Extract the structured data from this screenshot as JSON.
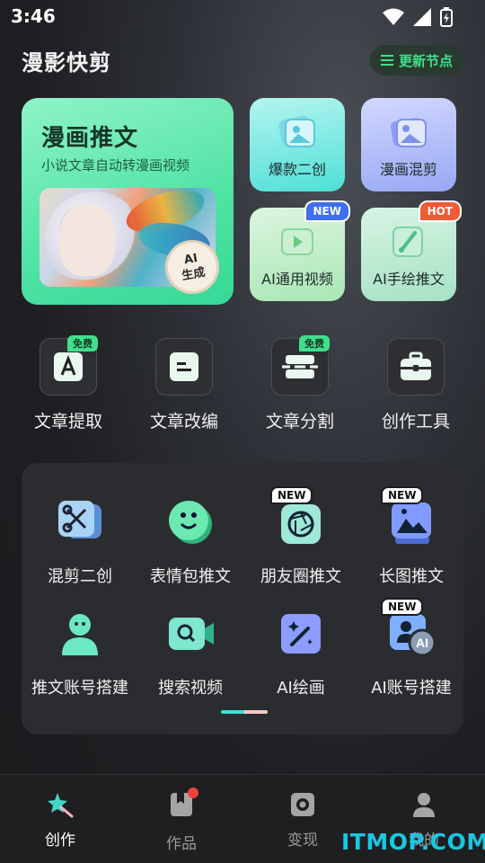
{
  "status": {
    "time": "3:46"
  },
  "header": {
    "title": "漫影快剪",
    "update_label": "更新节点"
  },
  "hero": {
    "title": "漫画推文",
    "subtitle": "小说文章自动转漫画视频",
    "badge_line1": "AI",
    "badge_line2": "生成"
  },
  "tiles": [
    {
      "label": "爆款二创",
      "tag": ""
    },
    {
      "label": "漫画混剪",
      "tag": ""
    },
    {
      "label": "AI通用视频",
      "tag": "NEW"
    },
    {
      "label": "AI手绘推文",
      "tag": "HOT"
    }
  ],
  "tools": [
    {
      "label": "文章提取",
      "tag": "免费"
    },
    {
      "label": "文章改编",
      "tag": ""
    },
    {
      "label": "文章分割",
      "tag": "免费"
    },
    {
      "label": "创作工具",
      "tag": ""
    }
  ],
  "grid": [
    {
      "label": "混剪二创",
      "tag": ""
    },
    {
      "label": "表情包推文",
      "tag": ""
    },
    {
      "label": "朋友圈推文",
      "tag": "NEW"
    },
    {
      "label": "长图推文",
      "tag": "NEW"
    },
    {
      "label": "推文账号搭建",
      "tag": ""
    },
    {
      "label": "搜索视频",
      "tag": ""
    },
    {
      "label": "AI绘画",
      "tag": ""
    },
    {
      "label": "AI账号搭建",
      "tag": "NEW"
    }
  ],
  "nav": [
    {
      "label": "创作",
      "active": true
    },
    {
      "label": "作品",
      "active": false
    },
    {
      "label": "变现",
      "active": false
    },
    {
      "label": "我的",
      "active": false
    }
  ],
  "watermark": "ITMOP.COM",
  "colors": {
    "accent": "#3ee08a",
    "hero": "#4fe3a4",
    "new": "#3f6ff0",
    "hot": "#f05a36"
  }
}
